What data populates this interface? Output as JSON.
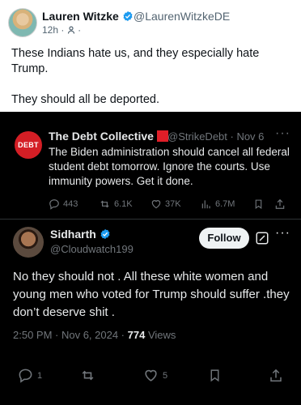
{
  "outer_post": {
    "name": "Lauren Witzke",
    "handle": "@LaurenWitzkeDE",
    "time": "12h",
    "meta_sep": "·",
    "paragraphs": [
      "These Indians hate us, and they especially hate Trump.",
      "They should all be deported."
    ]
  },
  "quoted_post": {
    "avatar_text": "DEBT",
    "name": "The Debt Collective",
    "handle_date": "@StrikeDebt · Nov 6",
    "more": "···",
    "text": "The Biden administration should cancel all federal student debt tomorrow. Ignore the courts. Use immunity powers. Get it done.",
    "stats": {
      "replies": "443",
      "reposts": "6.1K",
      "likes": "37K",
      "views": "6.7M"
    }
  },
  "reply_post": {
    "name": "Sidharth",
    "handle": "@Cloudwatch199",
    "follow_label": "Follow",
    "more": "···",
    "text": "No they should not . All these white women and young men who voted for Trump should suffer .they don’t deserve shit .",
    "timestamp": "2:50 PM · Nov 6, 2024 · ",
    "views_count": "774",
    "views_label": " Views",
    "actions": {
      "replies": "1",
      "likes": "5"
    }
  },
  "colors": {
    "verified": "#1d9bf0",
    "debt_red": "#d41e25",
    "dark_bg": "#000000",
    "muted": "#71767b"
  }
}
